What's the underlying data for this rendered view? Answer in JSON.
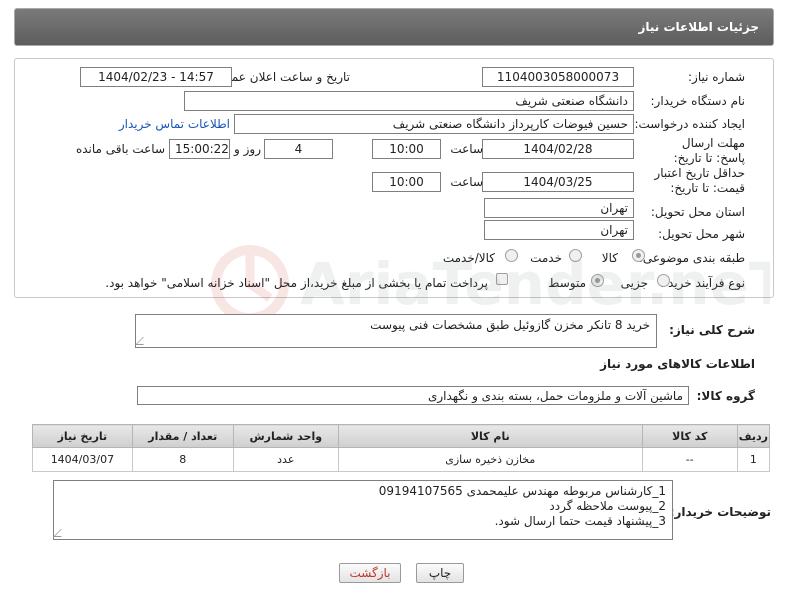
{
  "header": {
    "title": "جزئیات اطلاعات نیاز"
  },
  "form": {
    "need_number_label": "شماره نیاز:",
    "need_number": "1104003058000073",
    "announce_label": "تاریخ و ساعت اعلان عمومی:",
    "announce_value": "1404/02/23 - 14:57",
    "buyer_org_label": "نام دستگاه خریدار:",
    "buyer_org": "دانشگاه صنعتی شریف",
    "creator_label": "ایجاد کننده درخواست:",
    "creator": "حسین فیوضات کارپرداز دانشگاه صنعتی شریف",
    "contact_link": "اطلاعات تماس خریدار",
    "deadline_label": "مهلت ارسال پاسخ: تا تاریخ:",
    "deadline_date": "1404/02/28",
    "time_label": "ساعت",
    "deadline_time": "10:00",
    "days_value": "4",
    "days_label": "روز و",
    "remaining_time": "15:00:22",
    "remaining_label": "ساعت باقی مانده",
    "validity_label": "حداقل تاریخ اعتبار قیمت: تا تاریخ:",
    "validity_date": "1404/03/25",
    "validity_time": "10:00",
    "province_label": "استان محل تحویل:",
    "province": "تهران",
    "city_label": "شهر محل تحویل:",
    "city": "تهران",
    "category_label": "طبقه بندی موضوعی:",
    "category_options": [
      "کالا",
      "خدمت",
      "کالا/خدمت"
    ],
    "process_label": "نوع فرآیند خرید :",
    "process_options": [
      "جزیی",
      "متوسط"
    ],
    "payment_note": "پرداخت تمام یا بخشی از مبلغ خرید،از محل \"اسناد خزانه اسلامی\" خواهد بود."
  },
  "summary": {
    "label": "شرح کلی نیاز:",
    "value": "خرید 8 تانکر مخزن گازوئیل طبق مشخصات فنی پیوست"
  },
  "goods_section": {
    "title": "اطلاعات کالاهای مورد نیاز",
    "group_label": "گروه کالا:",
    "group_value": "ماشین آلات و ملزومات حمل، بسته بندی و نگهداری"
  },
  "table": {
    "headers": [
      "ردیف",
      "کد کالا",
      "نام کالا",
      "واحد شمارش",
      "تعداد / مقدار",
      "تاریخ نیاز"
    ],
    "rows": [
      {
        "row": "1",
        "code": "--",
        "name": "مخازن ذخیره سازی",
        "unit": "عدد",
        "qty": "8",
        "date": "1404/03/07"
      }
    ]
  },
  "buyer_notes": {
    "label": "توضیحات خریدار:",
    "line1": "1_کارشناس مربوطه مهندس علیمحمدی 09194107565",
    "line2": "2_پیوست ملاحظه گردد",
    "line3": "3_پیشنهاد قیمت حتما ارسال شود."
  },
  "buttons": {
    "print": "چاپ",
    "back": "بازگشت"
  },
  "colors": {
    "header_bg": "#6b6b6b",
    "link": "#1a55b8",
    "back_button_text": "#c0392b"
  }
}
